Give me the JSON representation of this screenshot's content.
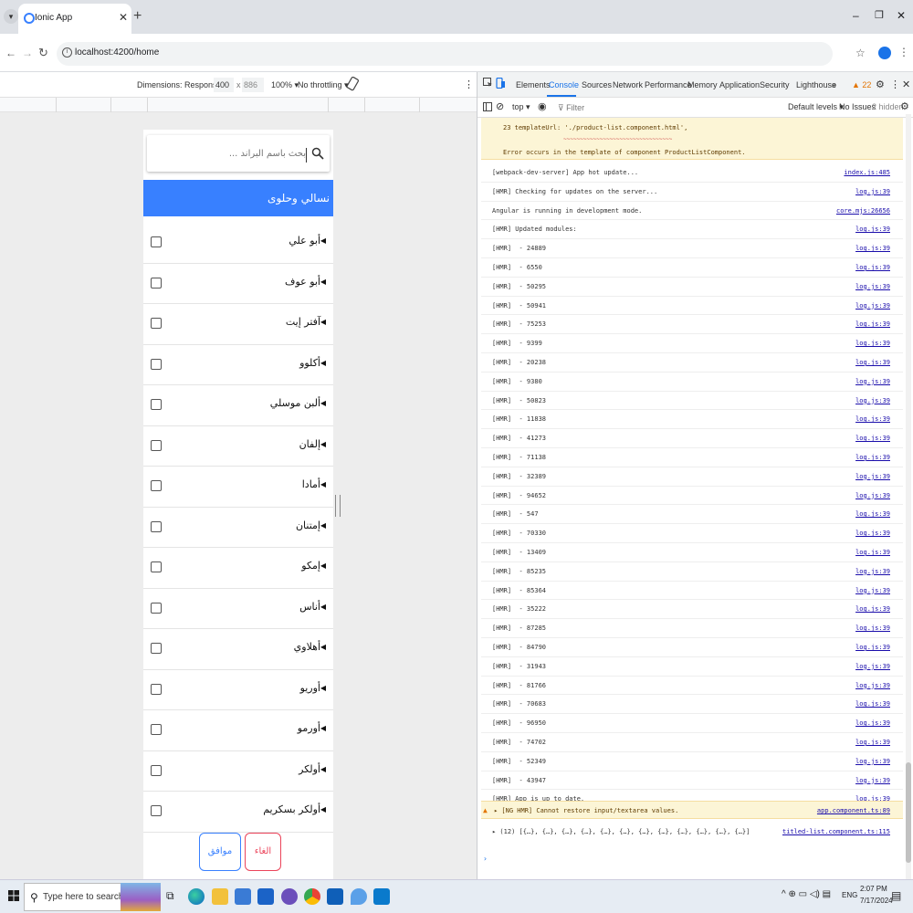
{
  "browser": {
    "tab_title": "Ionic App",
    "new_tab_glyph": "+",
    "url": "localhost:4200/home",
    "icons": [
      "tab-search-icon",
      "favicon-icon",
      "close-icon",
      "back-icon",
      "forward-icon",
      "reload-icon",
      "site-info-icon",
      "star-icon",
      "profile-icon",
      "more-icon"
    ]
  },
  "device_toolbar": {
    "dimensions_label": "Dimensions: Responsive ▾",
    "width": "400",
    "times": "x",
    "height": "886",
    "zoom": "100% ▾",
    "throttling": "No throttling ▾"
  },
  "app": {
    "search_placeholder": "بحث باسم البراند ...",
    "header_title": "نسالي وحلوى",
    "items": [
      {
        "label": "أبو علي",
        "checked": false
      },
      {
        "label": "أبو عوف",
        "checked": false
      },
      {
        "label": "آفتر إيت",
        "checked": false
      },
      {
        "label": "أكلوو",
        "checked": false
      },
      {
        "label": "ألبن موسلي",
        "checked": false
      },
      {
        "label": "إلفان",
        "checked": false
      },
      {
        "label": "أمادا",
        "checked": false
      },
      {
        "label": "إمتنان",
        "checked": false
      },
      {
        "label": "إمكو",
        "checked": false
      },
      {
        "label": "أناس",
        "checked": false
      },
      {
        "label": "أهلاوي",
        "checked": false
      },
      {
        "label": "أوريو",
        "checked": false
      },
      {
        "label": "أورمو",
        "checked": false
      },
      {
        "label": "أولكر",
        "checked": false
      },
      {
        "label": "أولكر بسكريم",
        "checked": false
      }
    ],
    "ok_label": "موافق",
    "cancel_label": "الغاء"
  },
  "devtools": {
    "tabs": [
      "Elements",
      "Console",
      "Sources",
      "Network",
      "Performance",
      "Memory",
      "Application",
      "Security",
      "Lighthouse",
      "»"
    ],
    "active_tab": "Console",
    "warning_count": "▲ 22",
    "context": "top ▾",
    "filter_placeholder": "Filter",
    "levels": "Default levels ▾",
    "issues": "No Issues",
    "hidden": "2 hidden",
    "error_line": "23    templateUrl: './product-list.component.html',",
    "error_underline": "~~~~~~~~~~~~~~~~~~~~~~~~~~~~~~~~~",
    "error_message": "Error occurs in the template of component ProductListComponent.",
    "logs": [
      {
        "text": "[webpack-dev-server] App hot update...",
        "src": "index.js:485"
      },
      {
        "text": "[HMR] Checking for updates on the server...",
        "src": "log.js:39"
      },
      {
        "text": "Angular is running in development mode.",
        "src": "core.mjs:26656"
      },
      {
        "text": "[HMR] Updated modules:",
        "src": "log.js:39"
      },
      {
        "text": "[HMR]  - 24889",
        "src": "log.js:39"
      },
      {
        "text": "[HMR]  - 6550",
        "src": "log.js:39"
      },
      {
        "text": "[HMR]  - 50295",
        "src": "log.js:39"
      },
      {
        "text": "[HMR]  - 50941",
        "src": "log.js:39"
      },
      {
        "text": "[HMR]  - 75253",
        "src": "log.js:39"
      },
      {
        "text": "[HMR]  - 9399",
        "src": "log.js:39"
      },
      {
        "text": "[HMR]  - 20238",
        "src": "log.js:39"
      },
      {
        "text": "[HMR]  - 9380",
        "src": "log.js:39"
      },
      {
        "text": "[HMR]  - 50823",
        "src": "log.js:39"
      },
      {
        "text": "[HMR]  - 11838",
        "src": "log.js:39"
      },
      {
        "text": "[HMR]  - 41273",
        "src": "log.js:39"
      },
      {
        "text": "[HMR]  - 71138",
        "src": "log.js:39"
      },
      {
        "text": "[HMR]  - 32389",
        "src": "log.js:39"
      },
      {
        "text": "[HMR]  - 94652",
        "src": "log.js:39"
      },
      {
        "text": "[HMR]  - 547",
        "src": "log.js:39"
      },
      {
        "text": "[HMR]  - 70330",
        "src": "log.js:39"
      },
      {
        "text": "[HMR]  - 13409",
        "src": "log.js:39"
      },
      {
        "text": "[HMR]  - 85235",
        "src": "log.js:39"
      },
      {
        "text": "[HMR]  - 85364",
        "src": "log.js:39"
      },
      {
        "text": "[HMR]  - 35222",
        "src": "log.js:39"
      },
      {
        "text": "[HMR]  - 87285",
        "src": "log.js:39"
      },
      {
        "text": "[HMR]  - 84790",
        "src": "log.js:39"
      },
      {
        "text": "[HMR]  - 31943",
        "src": "log.js:39"
      },
      {
        "text": "[HMR]  - 81766",
        "src": "log.js:39"
      },
      {
        "text": "[HMR]  - 70683",
        "src": "log.js:39"
      },
      {
        "text": "[HMR]  - 96950",
        "src": "log.js:39"
      },
      {
        "text": "[HMR]  - 74702",
        "src": "log.js:39"
      },
      {
        "text": "[HMR]  - 52349",
        "src": "log.js:39"
      },
      {
        "text": "[HMR]  - 43947",
        "src": "log.js:39"
      },
      {
        "text": "[HMR] App is up to date.",
        "src": "log.js:39"
      }
    ],
    "warning": {
      "text": "▸ [NG HMR] Cannot restore input/textarea values.",
      "src": "app.component.ts:89"
    },
    "array_log": {
      "text": "▸ (12) [{…}, {…}, {…}, {…}, {…}, {…}, {…}, {…}, {…}, {…}, {…}, {…}]",
      "src": "titled-list.component.ts:115"
    },
    "prompt": "›"
  },
  "taskbar": {
    "search_text": "Type here to search",
    "lang": "ENG",
    "time": "2:07 PM",
    "date": "7/17/2024"
  }
}
